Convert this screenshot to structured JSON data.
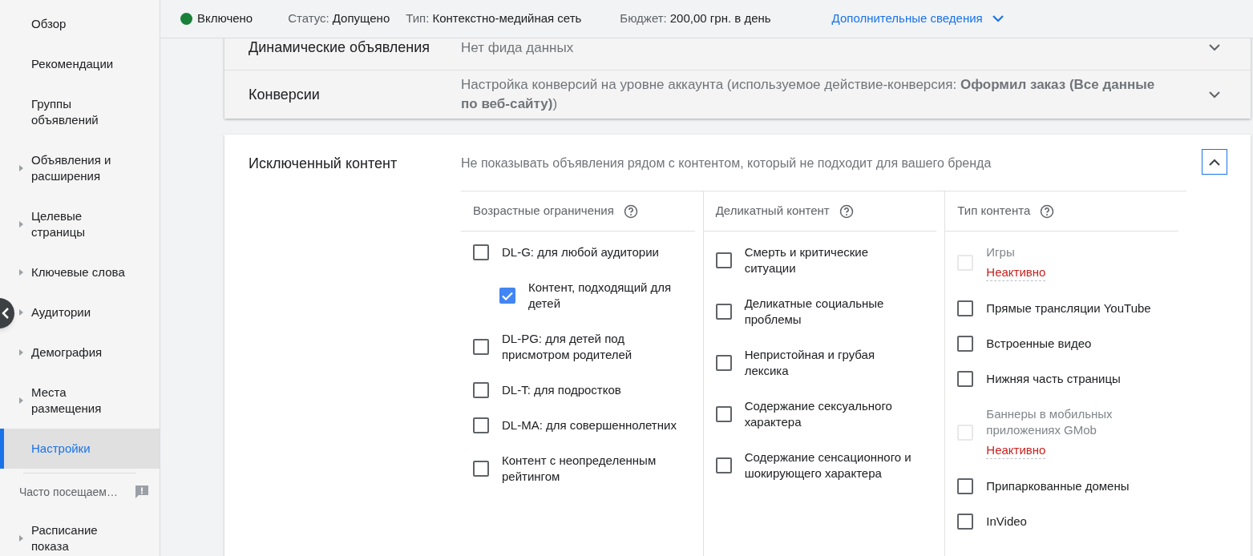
{
  "sidebar": {
    "items": [
      {
        "kind": "page",
        "label": "Обзор",
        "expandable": false,
        "selected": false
      },
      {
        "kind": "page",
        "label": "Рекомендации",
        "expandable": false,
        "selected": false
      },
      {
        "kind": "page",
        "label": "Группы объявлений",
        "expandable": false,
        "selected": false
      },
      {
        "kind": "page",
        "label": "Объявления и расширения",
        "expandable": true,
        "selected": false
      },
      {
        "kind": "page",
        "label": "Целевые страницы",
        "expandable": true,
        "selected": false
      },
      {
        "kind": "page",
        "label": "Ключевые слова",
        "expandable": true,
        "selected": false
      },
      {
        "kind": "page",
        "label": "Аудитории",
        "expandable": true,
        "selected": false
      },
      {
        "kind": "page",
        "label": "Демография",
        "expandable": true,
        "selected": false
      },
      {
        "kind": "page",
        "label": "Места размещения",
        "expandable": true,
        "selected": false
      },
      {
        "kind": "page",
        "label": "Настройки",
        "expandable": false,
        "selected": true
      },
      {
        "kind": "heading",
        "label": "Часто посещаем…"
      },
      {
        "kind": "page",
        "label": "Расписание показа",
        "expandable": true,
        "selected": false
      }
    ]
  },
  "header": {
    "enabled": true,
    "state_label": "Включено",
    "fields": [
      {
        "label": "Статус:",
        "value": "Допущено"
      },
      {
        "label": "Тип:",
        "value": "Контекстно-медийная сеть"
      },
      {
        "label": "Бюджет:",
        "value": "200,00 грн. в день"
      }
    ],
    "details_link": "Дополнительные сведения"
  },
  "sections": [
    {
      "title": "Динамические объявления",
      "description": "Нет фида данных",
      "expanded": false
    },
    {
      "title": "Конверсии",
      "description": "Настройка конверсий на уровне аккаунта (используемое действие-конверсия: **Оформил заказ (Все данные по веб-сайту)**)",
      "expanded": false
    }
  ],
  "exclusions": {
    "title": "Исключенный контент",
    "description": "Не показывать объявления рядом с контентом, который не подходит для вашего бренда",
    "expanded": true,
    "columns": [
      {
        "heading": "Возрастные ограничения",
        "items": [
          {
            "label": "DL-G: для любой аудитории",
            "checked": false,
            "disabled": false,
            "children": [
              {
                "label": "Контент, подходящий для детей",
                "checked": true,
                "disabled": false
              }
            ]
          },
          {
            "label": "DL-PG: для детей под присмотром родителей",
            "checked": false,
            "disabled": false
          },
          {
            "label": "DL-T: для подростков",
            "checked": false,
            "disabled": false
          },
          {
            "label": "DL-MA: для совершеннолетних",
            "checked": false,
            "disabled": false
          },
          {
            "label": "Контент с неопределенным рейтингом",
            "checked": false,
            "disabled": false
          }
        ]
      },
      {
        "heading": "Деликатный контент",
        "items": [
          {
            "label": "Смерть и критические ситуации",
            "checked": false,
            "disabled": false
          },
          {
            "label": "Деликатные социальные проблемы",
            "checked": false,
            "disabled": false
          },
          {
            "label": "Непристойная и грубая лексика",
            "checked": false,
            "disabled": false
          },
          {
            "label": "Содержание сексуального характера",
            "checked": false,
            "disabled": false
          },
          {
            "label": "Содержание сенсационного и шокирующего характера",
            "checked": false,
            "disabled": false
          }
        ]
      },
      {
        "heading": "Тип контента",
        "items": [
          {
            "label": "Игры",
            "checked": false,
            "disabled": true,
            "status": "Неактивно"
          },
          {
            "label": "Прямые трансляции YouTube",
            "checked": false,
            "disabled": false
          },
          {
            "label": "Встроенные видео",
            "checked": false,
            "disabled": false
          },
          {
            "label": "Нижняя часть страницы",
            "checked": false,
            "disabled": false
          },
          {
            "label": "Баннеры в мобильных приложениях GMob",
            "checked": false,
            "disabled": true,
            "status": "Неактивно"
          },
          {
            "label": "Припаркованные домены",
            "checked": false,
            "disabled": false
          },
          {
            "label": "InVideo",
            "checked": false,
            "disabled": false
          }
        ]
      }
    ]
  }
}
